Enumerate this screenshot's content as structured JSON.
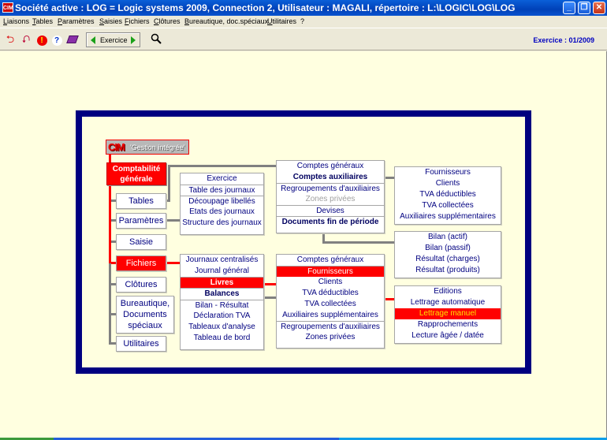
{
  "window": {
    "title": "Société active : LOG = Logic systems 2009, Connection 2, Utilisateur : MAGALI, répertoire : L:\\LOGIC\\LOG\\LOG",
    "app_icon_text": "CIM",
    "minimize": "_",
    "restore": "❐",
    "close": "✕"
  },
  "menubar": [
    {
      "accel": "L",
      "rest": "iaisons"
    },
    {
      "accel": "T",
      "rest": "ables"
    },
    {
      "accel": "P",
      "rest": "aramètres"
    },
    {
      "accel": "S",
      "rest": "aisies"
    },
    {
      "accel": "F",
      "rest": "ichiers"
    },
    {
      "accel": "C",
      "rest": "lôtures"
    },
    {
      "accel": "B",
      "rest": "ureautique, doc.spéciaux"
    },
    {
      "accel": "U",
      "rest": "tilitaires"
    },
    {
      "accel": "",
      "rest": "?"
    }
  ],
  "toolbar": {
    "icons": [
      "exit-icon",
      "import-icon",
      "alert-icon",
      "help-icon",
      "book-icon"
    ],
    "exercice_label": "Exercice",
    "search_icon": "search-icon",
    "exercice_info": "Exercice : 01/2009"
  },
  "diagram": {
    "logo": {
      "brand": "CIM",
      "tagline": "'Gestion intégrée'"
    },
    "root": {
      "line1": "Comptabilité",
      "line2": "générale"
    },
    "modules": [
      {
        "label": "Tables",
        "active": false
      },
      {
        "label": "Paramètres",
        "active": false
      },
      {
        "label": "Saisie",
        "active": false
      },
      {
        "label": "Fichiers",
        "active": true
      },
      {
        "label": "Clôtures",
        "active": false
      },
      {
        "label": "Bureautique, Documents spéciaux",
        "lines": [
          "Bureautique,",
          "Documents",
          "spéciaux"
        ],
        "active": false
      },
      {
        "label": "Utilitaires",
        "active": false
      }
    ],
    "tables_box": {
      "items": [
        "Exercice",
        "Table des journaux",
        "Découpage libellés",
        "Etats des journaux",
        "Structure des journaux"
      ]
    },
    "comptes_box": {
      "items": [
        "Comptes généraux",
        "Comptes auxiliaires",
        "Regroupements d'auxiliaires",
        "Zones privées",
        "Devises",
        "Documents fin de période"
      ]
    },
    "auxiliaires_box": {
      "items": [
        "Fournisseurs",
        "Clients",
        "TVA déductibles",
        "TVA collectées",
        "Auxiliaires supplémentaires"
      ]
    },
    "fin_periode_box": {
      "items": [
        "Bilan (actif)",
        "Bilan (passif)",
        "Résultat (charges)",
        "Résultat (produits)"
      ]
    },
    "fichiers_box": {
      "items": [
        "Journaux centralisés",
        "Journal général",
        "Livres",
        "Balances",
        "Bilan - Résultat",
        "Déclaration TVA",
        "Tableaux d'analyse",
        "Tableau de bord"
      ]
    },
    "livres_box": {
      "items": [
        "Comptes généraux",
        "Fournisseurs",
        "Clients",
        "TVA déductibles",
        "TVA collectées",
        "Auxiliaires supplémentaires",
        "Regroupements d'auxiliaires",
        "Zones privées"
      ]
    },
    "fournisseurs_box": {
      "items": [
        "Editions",
        "Lettrage automatique",
        "Lettrage manuel",
        "Rapprochements",
        "Lecture âgée / datée"
      ]
    }
  },
  "colors": {
    "title_bar": "#0041b8",
    "frame": "#000080",
    "workspace": "#ffffe0",
    "highlight": "#ff0000",
    "text": "#000080"
  }
}
